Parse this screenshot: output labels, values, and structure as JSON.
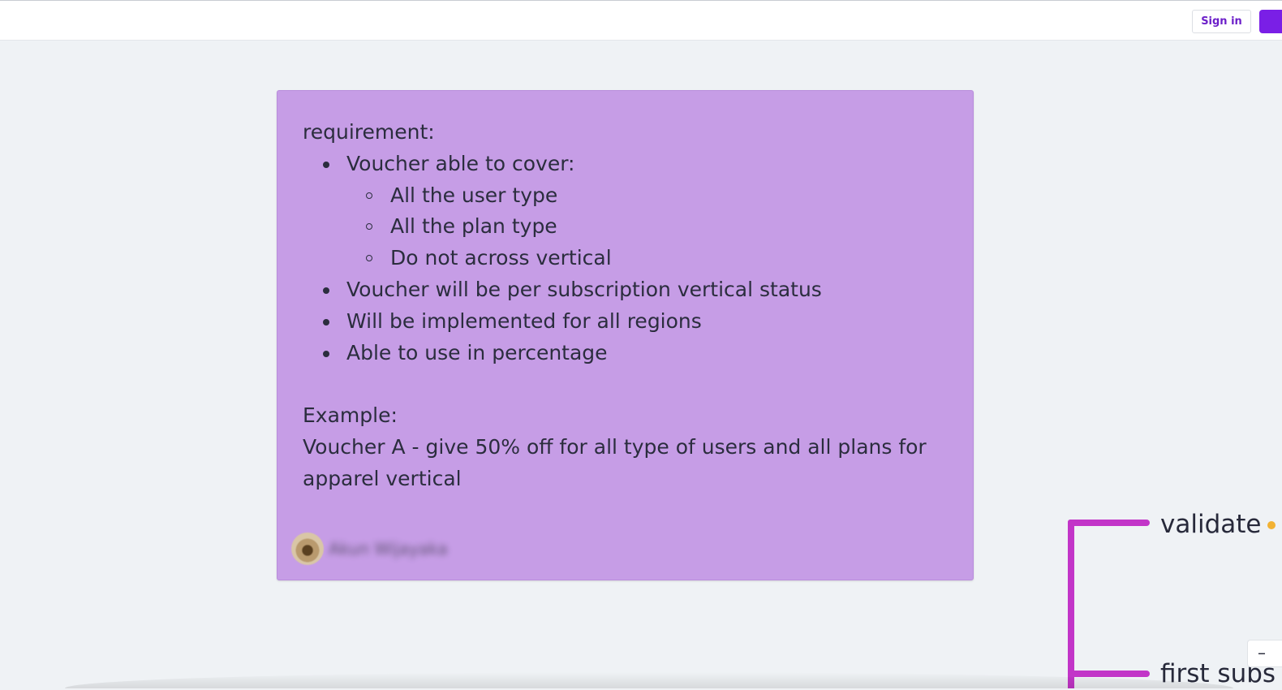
{
  "header": {
    "signin_label": "Sign in"
  },
  "sticky_note": {
    "color": "#c69de6",
    "heading": "requirement:",
    "bullets": [
      "Voucher able to cover:",
      "Voucher will be per subscription vertical status",
      "Will be implemented for all regions",
      "Able to use in percentage"
    ],
    "sub_bullets": [
      "All the user type",
      "All the plan type",
      "Do not across vertical"
    ],
    "example_label": "Example:",
    "example_line_1": "Voucher A - give 50% off for all type of users and all plans for",
    "example_line_2": "apparel vertical",
    "author_name": "Akun Wijayaka"
  },
  "mindmap": {
    "connector_color": "#c235c8",
    "nodes": [
      "validate",
      "first subs"
    ]
  },
  "zoom_controls": {
    "zoom_out_label": "–"
  }
}
